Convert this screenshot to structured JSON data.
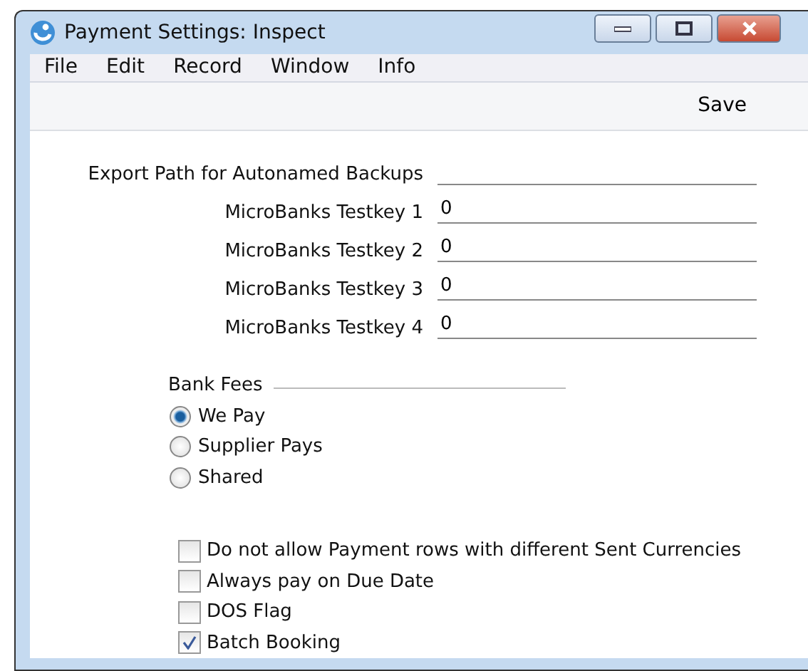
{
  "window": {
    "title": "Payment Settings: Inspect"
  },
  "menu": [
    "File",
    "Edit",
    "Record",
    "Window",
    "Info"
  ],
  "toolbar": {
    "buttons": [
      "Save"
    ]
  },
  "fields": [
    {
      "label": "Export Path for Autonamed Backups"
    },
    {
      "label": "MicroBanks Testkey 1",
      "value": "0"
    },
    {
      "label": "MicroBanks Testkey 2",
      "value": "0"
    },
    {
      "label": "MicroBanks Testkey 3",
      "value": "0"
    },
    {
      "label": "MicroBanks Testkey 4",
      "value": "0"
    }
  ],
  "bank_fees": {
    "title": "Bank Fees",
    "options": [
      {
        "label": "We Pay",
        "selected": true
      },
      {
        "label": "Supplier Pays",
        "selected": false
      },
      {
        "label": "Shared",
        "selected": false
      }
    ]
  },
  "checkboxes": [
    {
      "label": "Do not allow Payment rows with different Sent Currencies",
      "checked": false
    },
    {
      "label": "Always pay on Due Date",
      "checked": false
    },
    {
      "label": "DOS Flag",
      "checked": false
    },
    {
      "label": "Batch Booking",
      "checked": true
    }
  ]
}
